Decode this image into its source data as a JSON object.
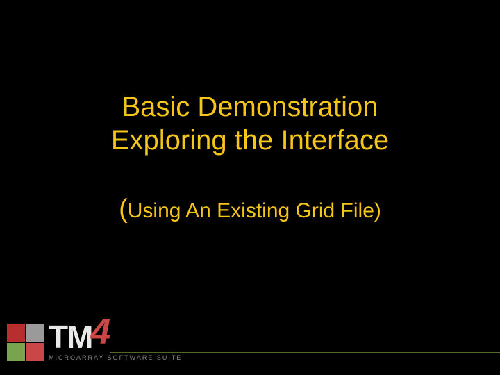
{
  "title": {
    "line1": "Basic Demonstration",
    "line2": "Exploring the Interface"
  },
  "subtitle": {
    "open_paren": "(",
    "text": "Using An Existing Grid File)",
    "full": "(Using An Existing Grid File)"
  },
  "logo": {
    "tm": "TM",
    "four": "4",
    "tagline": "MICROARRAY SOFTWARE SUITE"
  },
  "colors": {
    "title": "#f5c518",
    "bg": "#000000",
    "logo_red": "#c94747",
    "logo_green": "#7aa34f",
    "logo_gray": "#9a9a9a"
  }
}
